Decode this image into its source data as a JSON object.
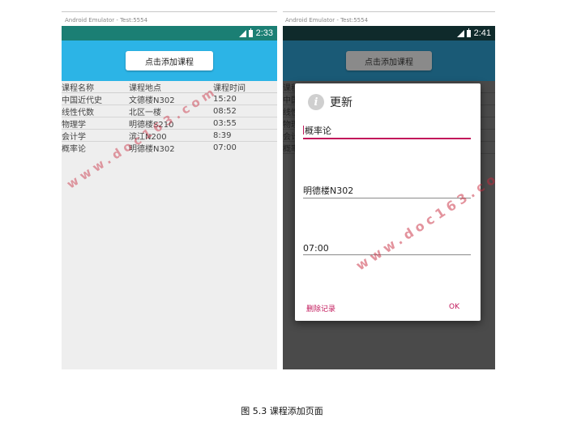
{
  "left_emulator": {
    "window_title": "Android Emulator - Test:5554",
    "status": {
      "time": "2:33"
    },
    "add_button_label": "点击添加课程",
    "table": {
      "headers": [
        "课程名称",
        "课程地点",
        "课程时间"
      ],
      "rows": [
        [
          "中国近代史",
          "文德楼N302",
          "15:20"
        ],
        [
          "线性代数",
          "北区一楼",
          "08:52"
        ],
        [
          "物理学",
          "明德楼S210",
          "03:55"
        ],
        [
          "会计学",
          "滨江N200",
          "8:39"
        ],
        [
          "概率论",
          "明德楼N302",
          "07:00"
        ]
      ]
    },
    "watermark": "www.doc163.com"
  },
  "right_emulator": {
    "window_title": "Android Emulator - Test:5554",
    "status": {
      "time": "2:41"
    },
    "add_button_label": "点击添加课程",
    "dimmed_rows": [
      "课程",
      "中国",
      "线性",
      "物理",
      "会计",
      "概率"
    ],
    "dialog": {
      "title": "更新",
      "fields": [
        "概率论",
        "明德楼N302",
        "07:00"
      ],
      "delete_label": "删除记录",
      "ok_label": "OK"
    },
    "watermark": "www.doc163.com"
  },
  "caption": "图 5.3 课程添加页面",
  "colors": {
    "left_toolbar": "#2cb4e6",
    "left_statusbar": "#1b7f74",
    "accent": "#c2185b"
  }
}
